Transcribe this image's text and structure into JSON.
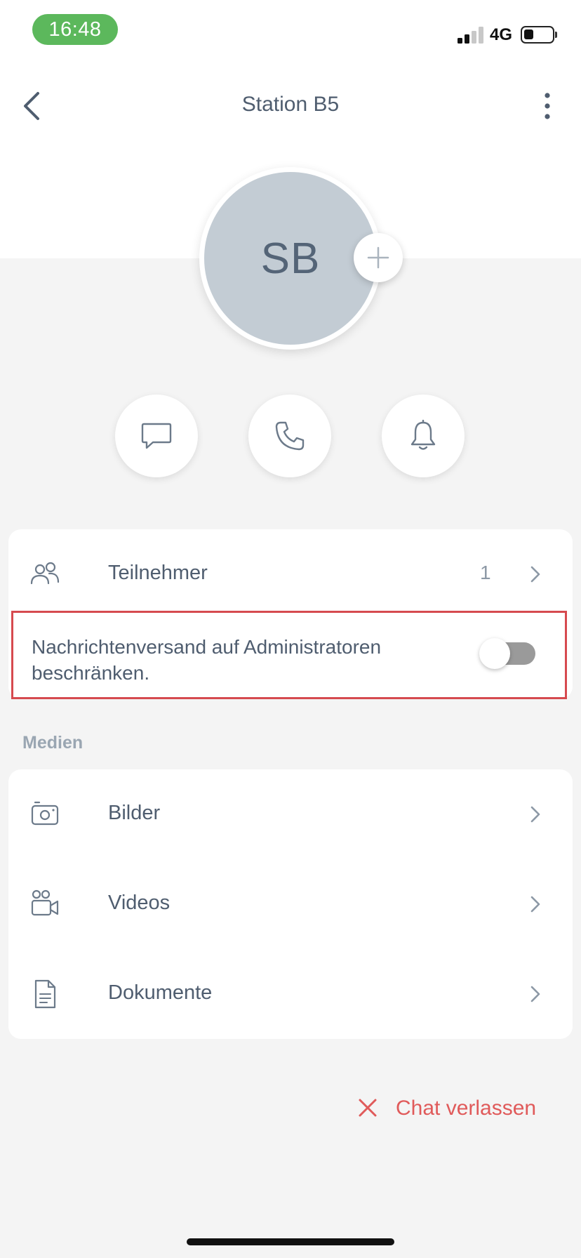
{
  "status_bar": {
    "time": "16:48",
    "network": "4G",
    "signal_bars": 2,
    "battery_level": 0.35
  },
  "header": {
    "title": "Station B5"
  },
  "avatar": {
    "initials": "SB"
  },
  "actions": [
    {
      "name": "message",
      "icon": "chat-bubble-icon"
    },
    {
      "name": "call",
      "icon": "phone-icon"
    },
    {
      "name": "notifications",
      "icon": "bell-icon"
    }
  ],
  "participants": {
    "label": "Teilnehmer",
    "count": "1",
    "icon": "people-icon"
  },
  "restrict_messages": {
    "label": "Nachrichtenversand auf Administratoren beschränken.",
    "enabled": false
  },
  "media": {
    "section_label": "Medien",
    "items": [
      {
        "label": "Bilder",
        "icon": "camera-icon"
      },
      {
        "label": "Videos",
        "icon": "video-camera-icon"
      },
      {
        "label": "Dokumente",
        "icon": "document-icon"
      }
    ]
  },
  "leave_chat": {
    "label": "Chat verlassen",
    "color": "#e05a5a"
  },
  "colors": {
    "status_pill": "#5cb85c",
    "avatar_bg": "#c3ccd4",
    "text": "#4f5d6f",
    "highlight_border": "#d64a4f"
  }
}
